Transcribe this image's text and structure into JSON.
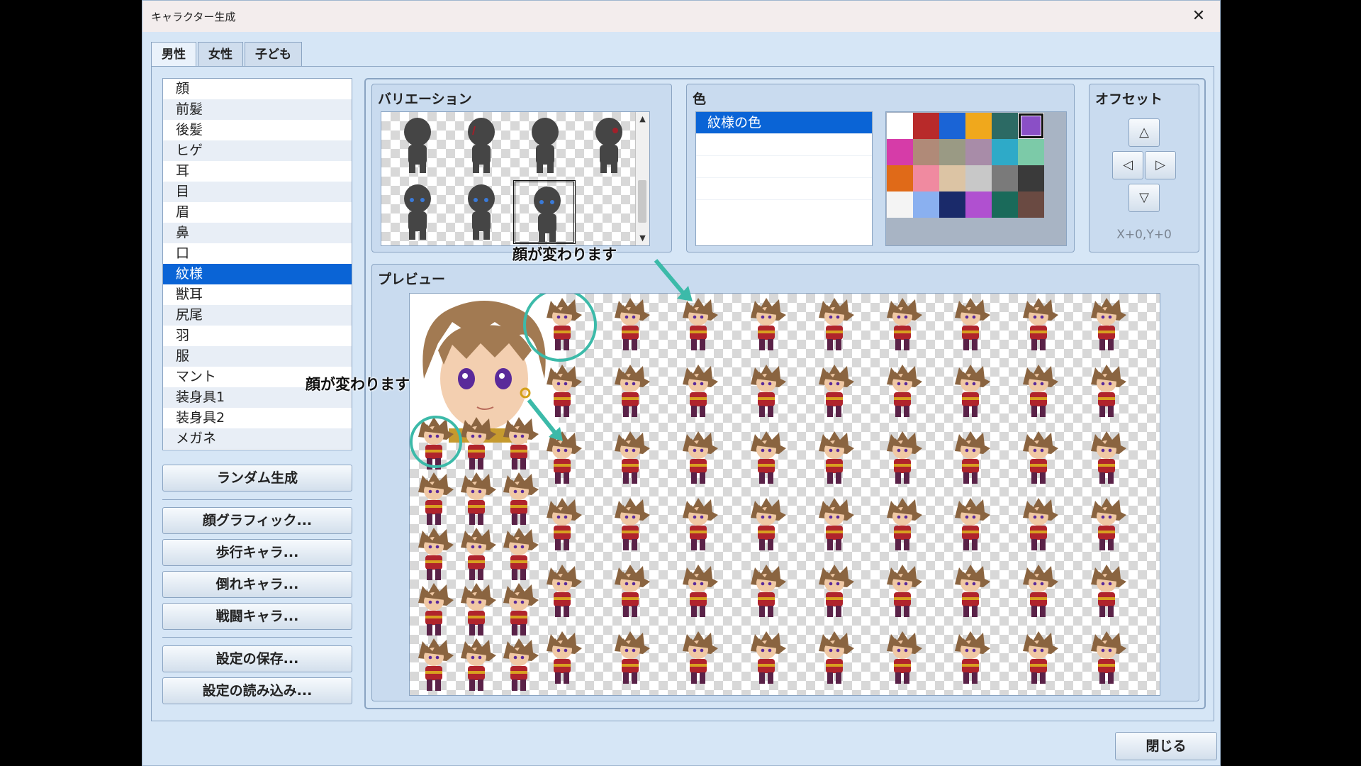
{
  "window": {
    "title": "キャラクター生成",
    "close_glyph": "✕"
  },
  "tabs": [
    {
      "label": "男性",
      "active": true
    },
    {
      "label": "女性",
      "active": false
    },
    {
      "label": "子ども",
      "active": false
    }
  ],
  "parts": {
    "items": [
      "顔",
      "前髪",
      "後髪",
      "ヒゲ",
      "耳",
      "目",
      "眉",
      "鼻",
      "口",
      "紋様",
      "獣耳",
      "尻尾",
      "羽",
      "服",
      "マント",
      "装身具1",
      "装身具2",
      "メガネ"
    ],
    "selected_index": 9
  },
  "buttons": {
    "random": "ランダム生成",
    "face_graphic": "顔グラフィック...",
    "walk_char": "歩行キャラ...",
    "down_char": "倒れキャラ...",
    "battle_char": "戦闘キャラ...",
    "save_settings": "設定の保存...",
    "load_settings": "設定の読み込み...",
    "close": "閉じる"
  },
  "variation": {
    "title": "バリエーション",
    "selected_index": 6,
    "count": 7
  },
  "color": {
    "title": "色",
    "items": [
      "紋様の色"
    ],
    "selected_item": 0,
    "palette": [
      "#ffffff",
      "#b82a2a",
      "#1a64d6",
      "#f0a81c",
      "#2c6a64",
      "#8a4fc6",
      "#d63ca8",
      "#b08a78",
      "#9a9a84",
      "#a88ca8",
      "#2eaac8",
      "#7ccaa8",
      "#e06a18",
      "#f08aa0",
      "#dcc4a4",
      "#c8c8c8",
      "#7a7a7a",
      "#3a3a3a",
      "#f4f4f4",
      "#8ab0f0",
      "#1a2a6a",
      "#b050d0",
      "#1a6a5a",
      "#6a4a42"
    ],
    "selected_swatch": 5
  },
  "offset": {
    "title": "オフセット",
    "up": "△",
    "left": "◁",
    "right": "▷",
    "down": "▽",
    "readout": "X+0,Y+0"
  },
  "preview": {
    "title": "プレビュー"
  },
  "annotations": {
    "note_top": "顔が変わります",
    "note_left": "顔が変わります",
    "accent": "#3cbaa9"
  }
}
